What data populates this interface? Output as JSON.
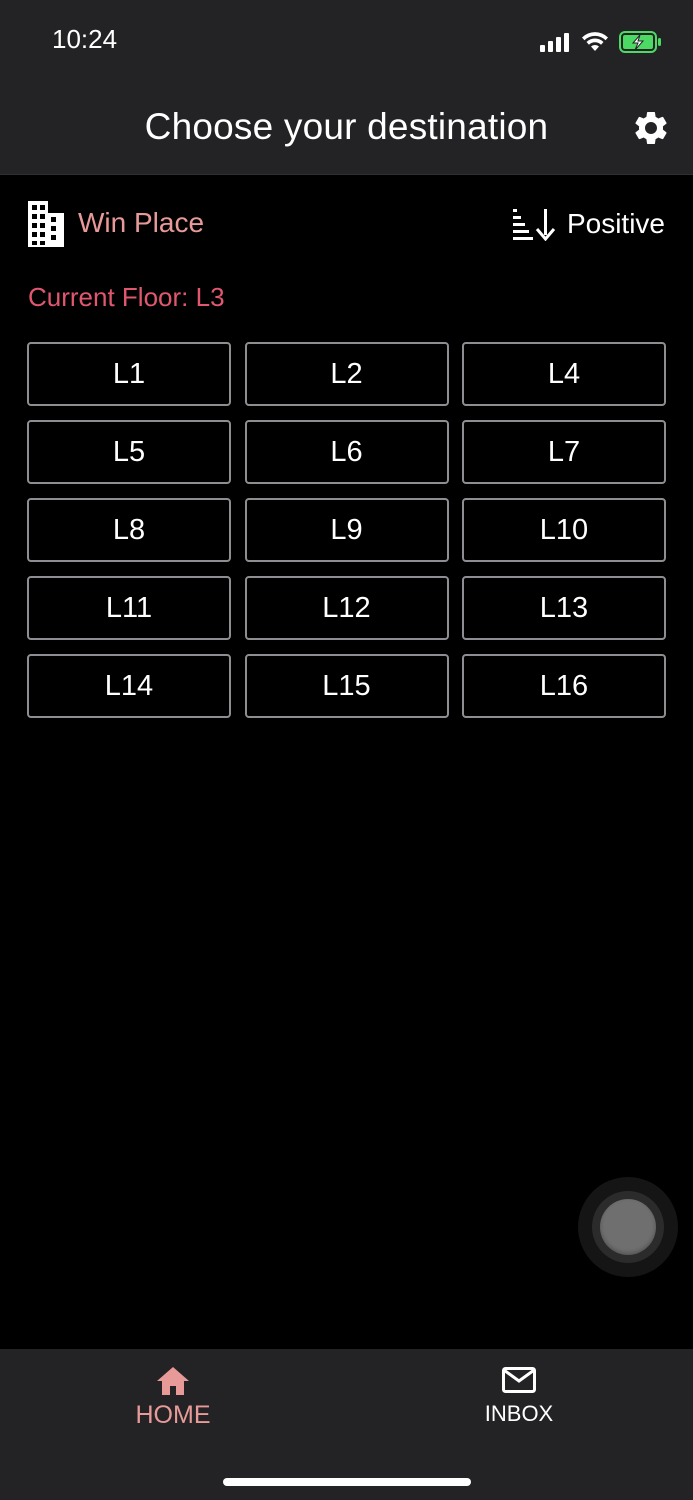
{
  "status_bar": {
    "time": "10:24",
    "icons": [
      "cellular-signal-icon",
      "wifi-icon",
      "battery-charging-icon"
    ],
    "battery_color": "#4cd964"
  },
  "header": {
    "title": "Choose your destination",
    "settings_icon": "gear-icon"
  },
  "building": {
    "icon": "building-icon",
    "name": "Win Place"
  },
  "sort": {
    "icon": "sort-descending-icon",
    "label": "Positive"
  },
  "current_floor_label": "Current Floor: L3",
  "floors": [
    "L1",
    "L2",
    "L4",
    "L5",
    "L6",
    "L7",
    "L8",
    "L9",
    "L10",
    "L11",
    "L12",
    "L13",
    "L14",
    "L15",
    "L16"
  ],
  "tabs": [
    {
      "label": "HOME",
      "icon": "home-icon",
      "active": true
    },
    {
      "label": "INBOX",
      "icon": "mail-icon",
      "active": false
    }
  ],
  "colors": {
    "accent": "#e89a98",
    "current_floor": "#e0576f",
    "background": "#000000",
    "bar": "#232326"
  }
}
